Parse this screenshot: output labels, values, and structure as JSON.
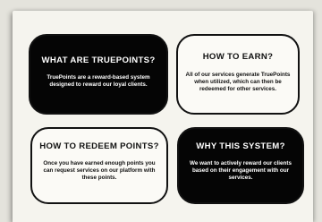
{
  "cards": [
    {
      "title": "WHAT ARE TRUEPOINTS?",
      "body": "TruePoints are a reward-based system designed to reward our loyal clients."
    },
    {
      "title": "HOW TO EARN?",
      "body": "All of our services generate TruePoints when utilized, which can then be redeemed for other services."
    },
    {
      "title": "HOW TO REDEEM POINTS?",
      "body": "Once you have earned enough points you can request services on our platform with these points."
    },
    {
      "title": "WHY THIS SYSTEM?",
      "body": "We want to actively reward our clients based on their engagement with our services."
    }
  ],
  "colors": {
    "dark_card": "#050505",
    "light_card": "#fbfaf6",
    "page": "#f5f4ee"
  }
}
